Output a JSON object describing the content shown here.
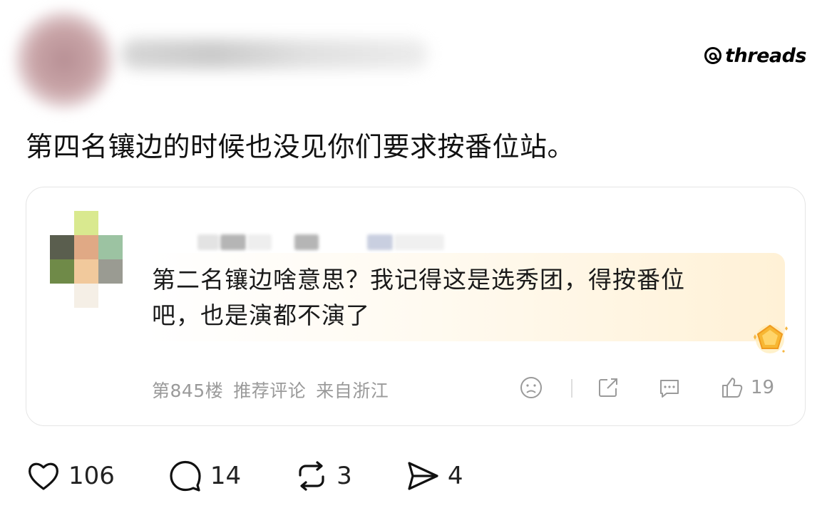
{
  "brand": {
    "name": "threads",
    "icon": "threads-logo-icon"
  },
  "post": {
    "text": "第四名镶边的时候也没见你们要求按番位站。"
  },
  "screenshot_card": {
    "comment_line1": "第二名镶边啥意思？我记得这是选秀团，得按番位",
    "comment_line2": "吧，也是演都不演了",
    "floor": "第845楼",
    "tag": "推荐评论",
    "location": "来自浙江",
    "like_count": "19",
    "icons": [
      "sad-face-icon",
      "share-icon",
      "comment-icon",
      "thumbs-up-icon",
      "gem-badge-icon"
    ]
  },
  "actions": {
    "likes": "106",
    "replies": "14",
    "reposts": "3",
    "shares": "4"
  }
}
